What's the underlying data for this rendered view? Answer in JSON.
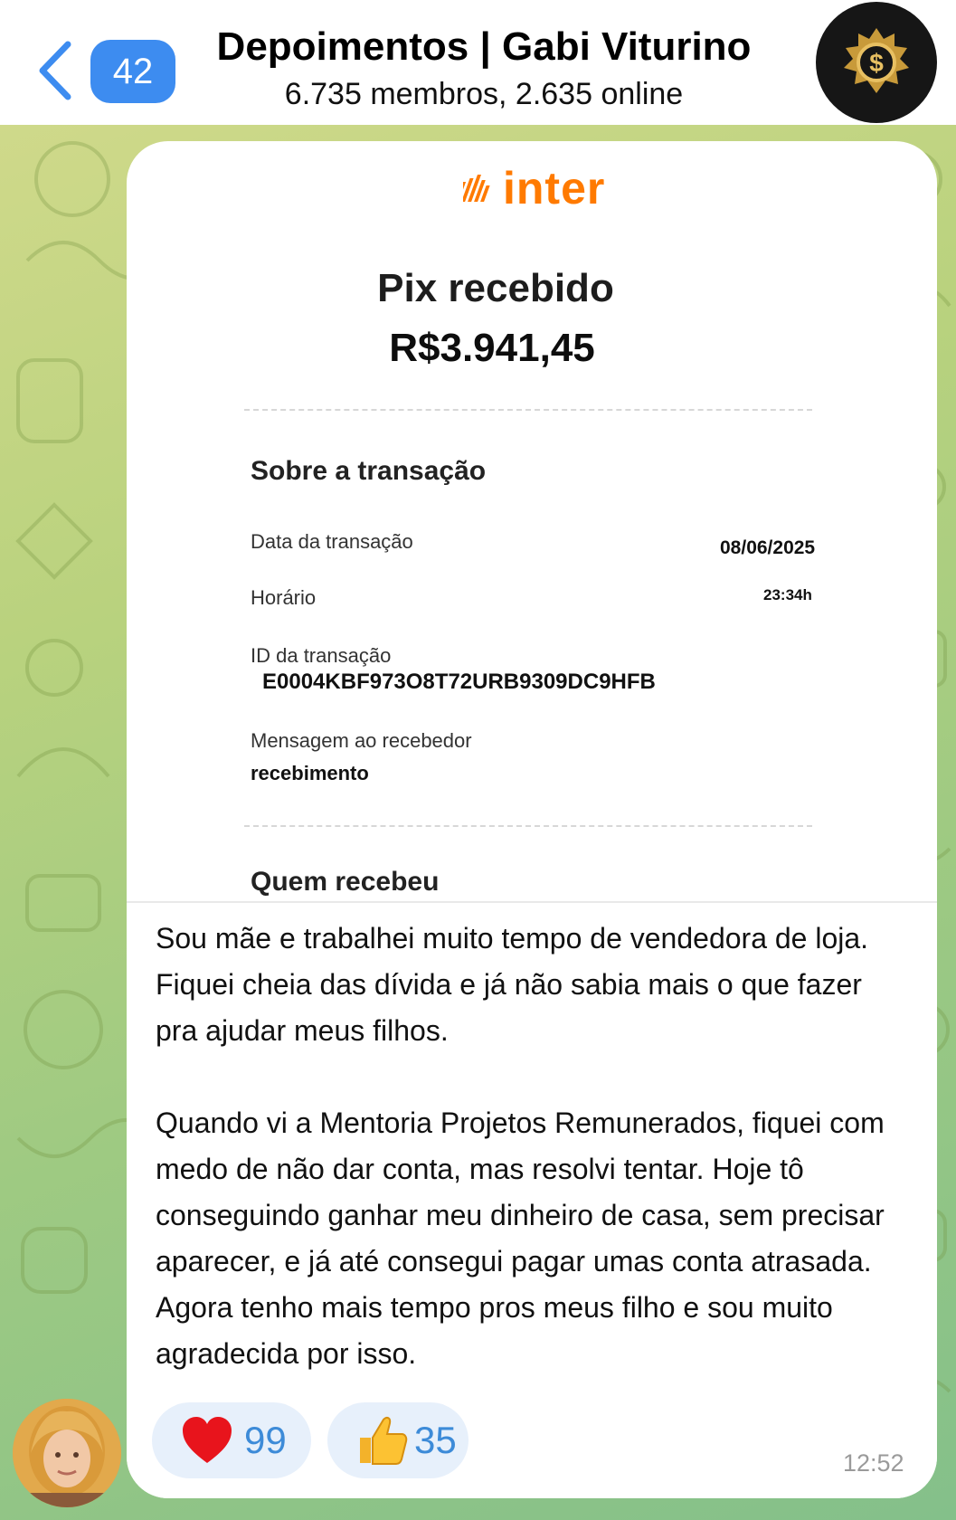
{
  "header": {
    "back_label": "back",
    "unread_count": "42",
    "title": "Depoimentos | Gabi Viturino",
    "subtitle": "6.735 membros, 2.635 online"
  },
  "receipt": {
    "brand": "inter",
    "heading": "Pix recebido",
    "amount": "R$3.941,45",
    "section_title": "Sobre a transação",
    "date_label": "Data da transação",
    "date_value": "08/06/2025",
    "time_label": "Horário",
    "time_value": "23:34h",
    "id_label": "ID da transação",
    "id_value": "E0004KBF973O8T72URB9309DC9HFB",
    "message_label": "Mensagem ao recebedor",
    "message_value": "recebimento",
    "receiver_title": "Quem recebeu"
  },
  "message": {
    "paragraph1": "Sou mãe e trabalhei muito tempo de vendedora de loja. Fiquei cheia das dívida e já não sabia mais o que fazer pra ajudar meus filhos.",
    "paragraph2": "Quando vi a Mentoria Projetos Remunerados, fiquei com medo de não dar conta, mas resolvi tentar. Hoje tô conseguindo ganhar meu dinheiro de casa, sem precisar aparecer, e já até consegui pagar umas conta atrasada. Agora tenho mais tempo pros meus filho e sou muito agradecida por isso.",
    "time": "12:52"
  },
  "reactions": [
    {
      "emoji": "heart-icon",
      "count": "99"
    },
    {
      "emoji": "thumbs-up-icon",
      "count": "35"
    }
  ],
  "colors": {
    "accent_blue": "#3d8cf0",
    "inter_orange": "#ff7a00",
    "reaction_bg": "#e7f0fb",
    "reaction_text": "#3d8bd8",
    "heart_red": "#e8141c"
  }
}
